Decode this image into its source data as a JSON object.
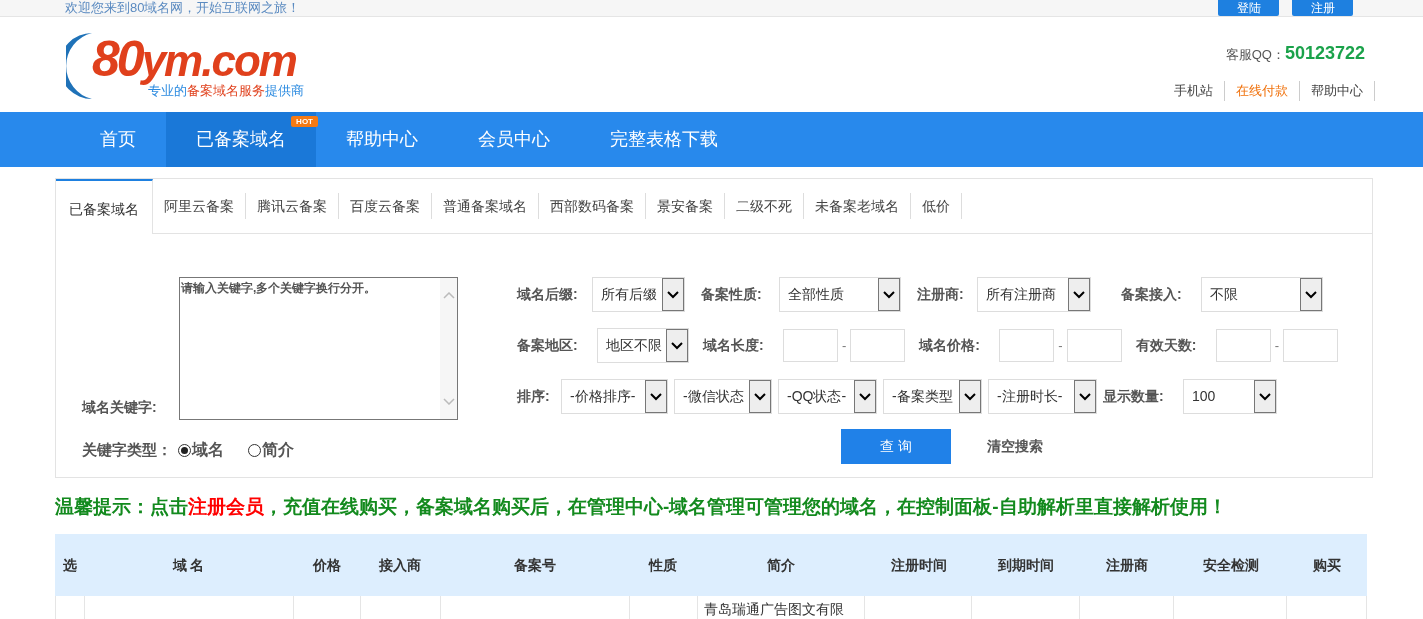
{
  "top_bar": {
    "welcome": "欢迎您来到80域名网，开始互联网之旅！",
    "buttons": [
      "登陆",
      "注册"
    ]
  },
  "header": {
    "logo": {
      "number": "80",
      "name": "ym.com",
      "slogan_parts": [
        {
          "text": "专业的",
          "highlight": false
        },
        {
          "text": "备案域名服务",
          "highlight": true
        },
        {
          "text": "提供商",
          "highlight": false
        }
      ]
    },
    "qq_label": "客服QQ：",
    "qq": "50123722",
    "links": [
      {
        "label": "手机站",
        "highlight": false
      },
      {
        "label": "在线付款",
        "highlight": true
      },
      {
        "label": "帮助中心",
        "highlight": false
      }
    ]
  },
  "nav": [
    {
      "label": "首页",
      "selected": false
    },
    {
      "label": "已备案域名",
      "selected": true,
      "badge": "HOT"
    },
    {
      "label": "帮助中心",
      "selected": false
    },
    {
      "label": "会员中心",
      "selected": false
    },
    {
      "label": "完整表格下载",
      "selected": false
    }
  ],
  "tabs": [
    {
      "label": "已备案域名",
      "selected": true
    },
    {
      "label": "阿里云备案",
      "selected": false
    },
    {
      "label": "腾讯云备案",
      "selected": false
    },
    {
      "label": "百度云备案",
      "selected": false
    },
    {
      "label": "普通备案域名",
      "selected": false
    },
    {
      "label": "西部数码备案",
      "selected": false
    },
    {
      "label": "景安备案",
      "selected": false
    },
    {
      "label": "二级不死",
      "selected": false
    },
    {
      "label": "未备案老域名",
      "selected": false
    },
    {
      "label": "低价",
      "selected": false
    }
  ],
  "search": {
    "keyword_label": "域名关键字:",
    "keyword_placeholder": "请输入关键字,多个关键字换行分开。",
    "type_label": "关键字类型：",
    "type_options": [
      {
        "label": "域名",
        "selected": true
      },
      {
        "label": "简介",
        "selected": false
      }
    ],
    "filter_rows": [
      [
        {
          "kind": "select",
          "label": "域名后缀:",
          "value": "所有后缀"
        },
        {
          "kind": "select",
          "label": "备案性质:",
          "value": "全部性质"
        },
        {
          "kind": "select",
          "label": "注册商:",
          "value": "所有注册商"
        },
        {
          "kind": "select",
          "label": "备案接入:",
          "value": "不限"
        }
      ],
      [
        {
          "kind": "select",
          "label": "备案地区:",
          "value": "地区不限"
        },
        {
          "kind": "range",
          "label": "域名长度:",
          "separator": "-"
        },
        {
          "kind": "range",
          "label": "域名价格:",
          "separator": "-"
        },
        {
          "kind": "range",
          "label": "有效天数:",
          "separator": "-"
        }
      ],
      [
        {
          "kind": "select",
          "label": "排序:",
          "value": "-价格排序-"
        },
        {
          "kind": "select",
          "value": "-微信状态"
        },
        {
          "kind": "select",
          "value": "-QQ状态-"
        },
        {
          "kind": "select",
          "value": "-备案类型"
        },
        {
          "kind": "select",
          "value": "-注册时长-"
        },
        {
          "kind": "select",
          "label": "显示数量:",
          "value": "100"
        }
      ]
    ],
    "submit": "查 询",
    "clear": "清空搜索"
  },
  "tip": [
    {
      "text": "温馨提示：点击",
      "highlight": false
    },
    {
      "text": "注册会员",
      "highlight": true
    },
    {
      "text": "，充值在线购买，备案域名购买后，在管理中心-域名管理可管理您的域名，在控制面板-自助解析里直接解析使用！",
      "highlight": false
    }
  ],
  "table": {
    "columns": [
      "选",
      "域 名",
      "价格",
      "接入商",
      "备案号",
      "性质",
      "简介",
      "注册时间",
      "到期时间",
      "注册商",
      "安全检测",
      "购买"
    ],
    "rows": [
      {
        "intro": "青岛瑞通广告图文有限"
      }
    ]
  }
}
